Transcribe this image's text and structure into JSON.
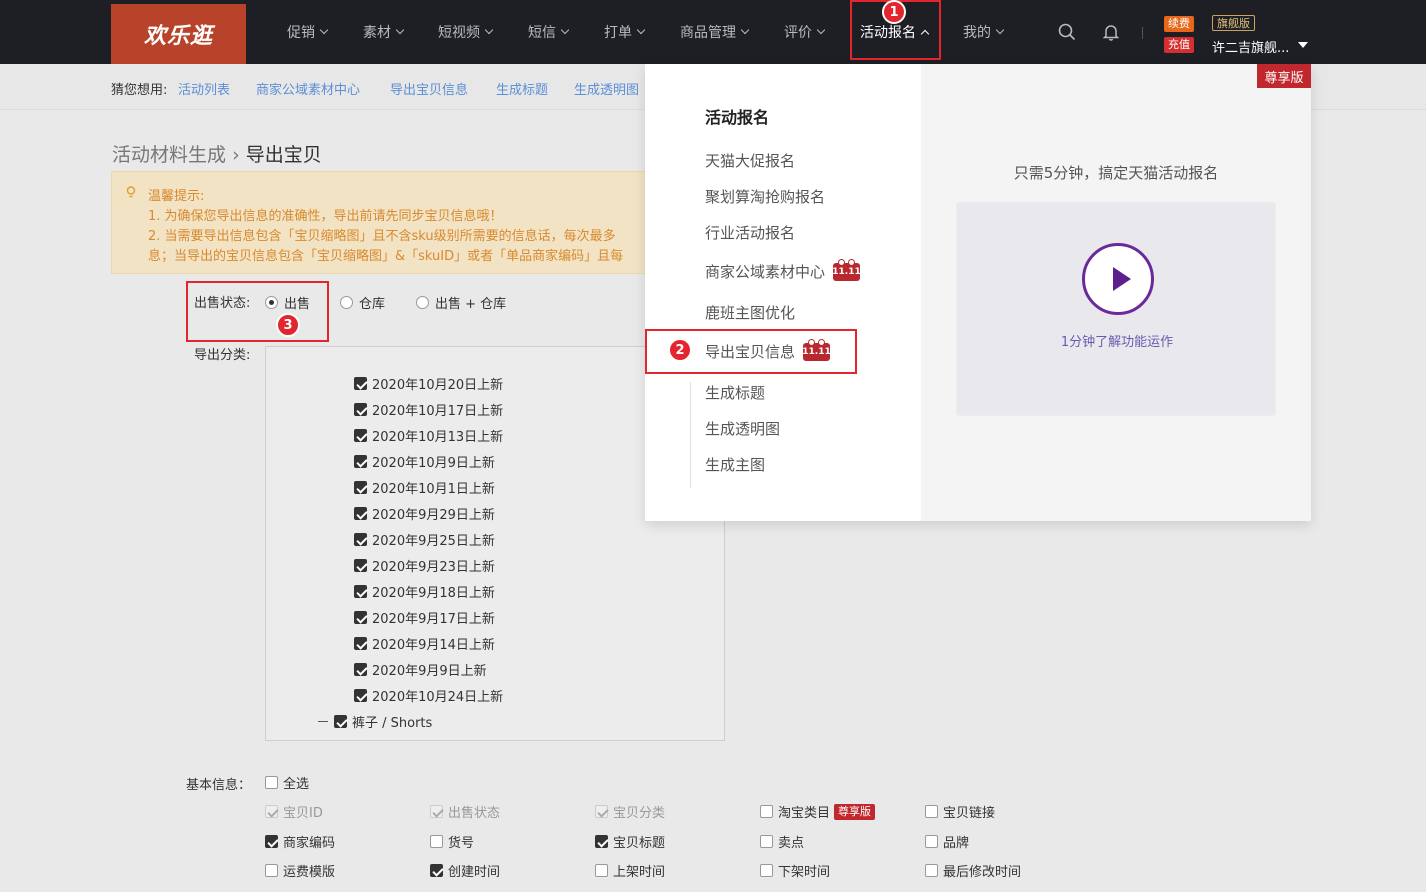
{
  "header": {
    "logo": "欢乐逛",
    "nav": [
      {
        "label": "促销"
      },
      {
        "label": "素材"
      },
      {
        "label": "短视频"
      },
      {
        "label": "短信"
      },
      {
        "label": "打单"
      },
      {
        "label": "商品管理"
      },
      {
        "label": "评价"
      },
      {
        "label": "活动报名"
      },
      {
        "label": "我的"
      }
    ],
    "renew_tag": "续费",
    "recharge_tag": "充值",
    "edition_tag": "旗舰版",
    "user_name": "许二吉旗舰..."
  },
  "guess": {
    "label": "猜您想用:",
    "links": [
      "活动列表",
      "商家公域素材中心",
      "导出宝贝信息",
      "生成标题",
      "生成透明图"
    ]
  },
  "breadcrumb": {
    "parent": "活动材料生成",
    "sep": "›",
    "current": "导出宝贝"
  },
  "tips": {
    "title": "温馨提示:",
    "line1": "1. 为确保您导出信息的准确性，导出前请先同步宝贝信息哦！",
    "line2": "2. 当需要导出信息包含「宝贝缩略图」且不含sku级别所需要的信息话，每次最多",
    "line3": "息；当导出的宝贝信息包含「宝贝缩略图」&「skuID」或者「单品商家编码」且每"
  },
  "form": {
    "status_label": "出售状态:",
    "status_options": [
      "出售",
      "仓库",
      "出售 + 仓库"
    ],
    "category_label": "导出分类:",
    "categories": [
      "2020年10月20日上新",
      "2020年10月17日上新",
      "2020年10月13日上新",
      "2020年10月9日上新",
      "2020年10月1日上新",
      "2020年9月29日上新",
      "2020年9月25日上新",
      "2020年9月23日上新",
      "2020年9月18日上新",
      "2020年9月17日上新",
      "2020年9月14日上新",
      "2020年9月9日上新",
      "2020年10月24日上新"
    ],
    "category_partial": "裤子 / Shorts",
    "basic_label": "基本信息：",
    "select_all": "全选",
    "fields": [
      {
        "label": "宝贝ID",
        "state": "disabled"
      },
      {
        "label": "出售状态",
        "state": "disabled"
      },
      {
        "label": "宝贝分类",
        "state": "disabled"
      },
      {
        "label": "淘宝类目",
        "state": "off",
        "tag": "尊享版"
      },
      {
        "label": "宝贝链接",
        "state": "off"
      },
      {
        "label": "商家编码",
        "state": "on"
      },
      {
        "label": "货号",
        "state": "off"
      },
      {
        "label": "宝贝标题",
        "state": "on"
      },
      {
        "label": "卖点",
        "state": "off"
      },
      {
        "label": "品牌",
        "state": "off"
      },
      {
        "label": "运费模版",
        "state": "off"
      },
      {
        "label": "创建时间",
        "state": "on"
      },
      {
        "label": "上架时间",
        "state": "off"
      },
      {
        "label": "下架时间",
        "state": "off"
      },
      {
        "label": "最后修改时间",
        "state": "off"
      }
    ]
  },
  "dropdown": {
    "title": "活动报名",
    "items": [
      "天猫大促报名",
      "聚划算淘抢购报名",
      "行业活动报名",
      "商家公域素材中心",
      "鹿班主图优化",
      "导出宝贝信息",
      "生成标题",
      "生成透明图",
      "生成主图"
    ],
    "promo_label": "11.11",
    "exclusive": "尊享版",
    "slogan": "只需5分钟，搞定天猫活动报名",
    "video_text": "1分钟了解功能运作"
  },
  "annotations": [
    "1",
    "2",
    "3"
  ],
  "colors": {
    "accent_red": "#e3262d",
    "logo_bg": "#b8432a",
    "link_blue": "#5b8fd6",
    "tip_text": "#d98a2e",
    "video_purple": "#6a2a9b"
  }
}
